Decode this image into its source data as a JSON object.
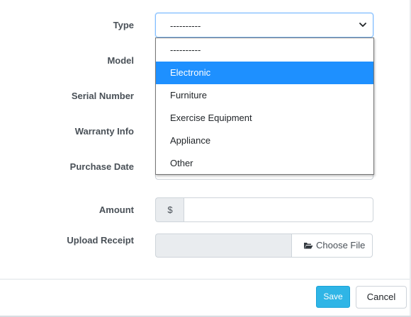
{
  "form": {
    "fields": {
      "type": {
        "label": "Type",
        "value": "----------"
      },
      "model": {
        "label": "Model"
      },
      "serial_number": {
        "label": "Serial Number"
      },
      "warranty_info": {
        "label": "Warranty Info"
      },
      "purchase_date": {
        "label": "Purchase Date"
      },
      "amount": {
        "label": "Amount",
        "prefix": "$",
        "value": ""
      },
      "upload_receipt": {
        "label": "Upload Receipt",
        "button_label": "Choose File"
      }
    }
  },
  "type_dropdown": {
    "open": true,
    "selected_index": 1,
    "options": [
      "----------",
      "Electronic",
      "Furniture",
      "Exercise Equipment",
      "Appliance",
      "Other"
    ],
    "highlight_color": "#1e90ff"
  },
  "footer": {
    "save_label": "Save",
    "cancel_label": "Cancel",
    "save_color": "#2fb5e6"
  },
  "icons": {
    "select_arrow": "chevron-down-icon",
    "file_button": "folder-open-icon"
  }
}
